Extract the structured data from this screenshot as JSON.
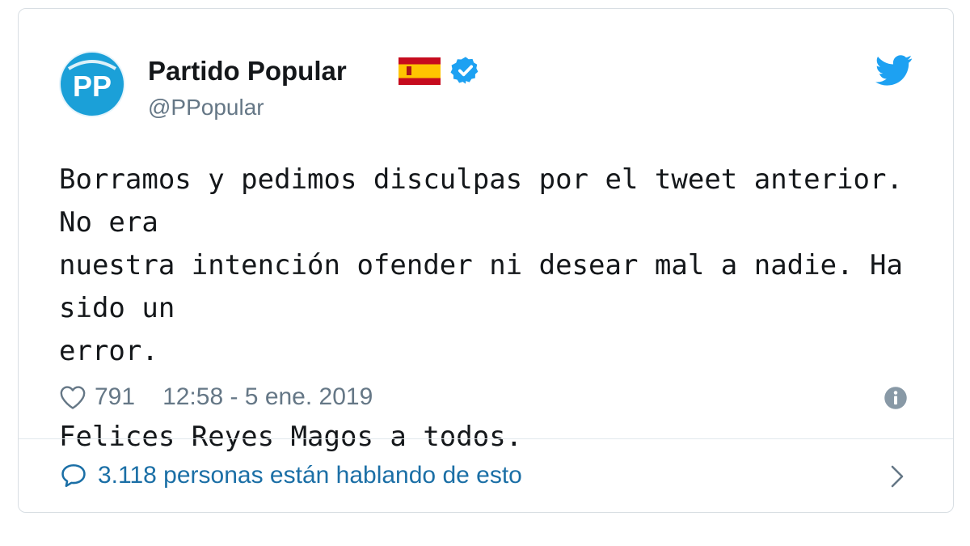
{
  "tweet": {
    "author_name": "Partido Popular",
    "handle": "@PPopular",
    "avatar_text": "PP",
    "text": "Borramos y pedimos disculpas por el tweet anterior. No era\nnuestra intención ofender ni desear mal a nadie. Ha sido un\nerror.\n\nFelices Reyes Magos a todos.",
    "likes": "791",
    "timestamp": "12:58 - 5 ene. 2019",
    "conversation": "3.118 personas están hablando de esto"
  },
  "icons": {
    "flag": "spain-flag-icon",
    "verified": "verified-badge-icon",
    "brand": "twitter-bird-icon",
    "like": "heart-icon",
    "info": "info-icon",
    "reply": "speech-bubble-icon",
    "more": "chevron-right-icon"
  },
  "colors": {
    "twitter_blue": "#1da1f2",
    "avatar_bg": "#1ba0d8",
    "text": "#14171a",
    "muted": "#657786",
    "link": "#1b6fa6",
    "flag_red": "#c60b1e",
    "flag_yellow": "#ffc400"
  }
}
